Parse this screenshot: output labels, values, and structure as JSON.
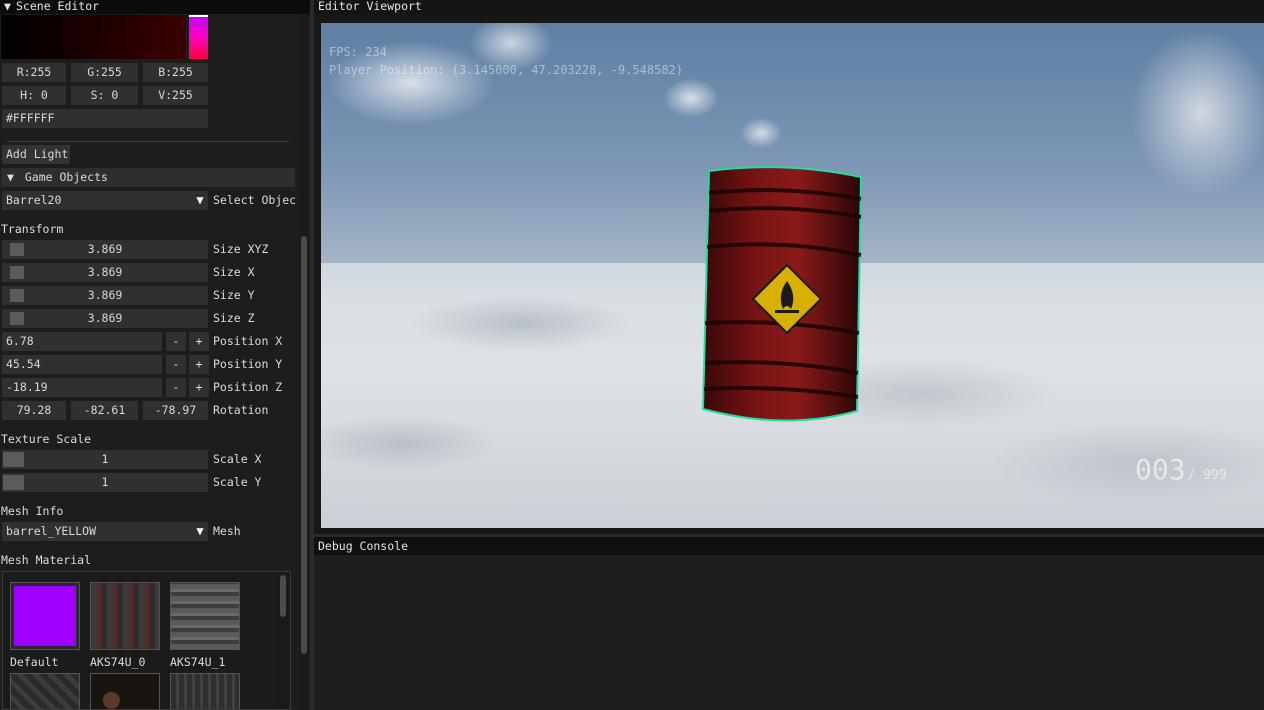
{
  "scene_editor": {
    "title": "Scene Editor",
    "color_picker": {
      "preview_color": "#ff00ff",
      "r": "R:255",
      "g": "G:255",
      "b": "B:255",
      "h": "H:  0",
      "s": "S:  0",
      "v": "V:255",
      "hex": "#FFFFFF"
    },
    "add_light_label": "Add Light",
    "game_objects_header": "Game Objects",
    "selected_object": "Barrel20",
    "select_object_label": "Select Object",
    "transform_label": "Transform",
    "size_xyz": {
      "value": "3.869",
      "label": "Size XYZ"
    },
    "size_x": {
      "value": "3.869",
      "label": "Size X"
    },
    "size_y": {
      "value": "3.869",
      "label": "Size Y"
    },
    "size_z": {
      "value": "3.869",
      "label": "Size Z"
    },
    "position_x": {
      "value": "6.78",
      "label": "Position X"
    },
    "position_y": {
      "value": "45.54",
      "label": "Position Y"
    },
    "position_z": {
      "value": "-18.19",
      "label": "Position Z"
    },
    "minus": "-",
    "plus": "+",
    "rotation": {
      "x": "79.28",
      "y": "-82.61",
      "z": "-78.97",
      "label": "Rotation"
    },
    "texture_scale_label": "Texture Scale",
    "scale_x": {
      "value": "1",
      "label": "Scale X"
    },
    "scale_y": {
      "value": "1",
      "label": "Scale Y"
    },
    "mesh_info_label": "Mesh Info",
    "mesh_value": "barrel_YELLOW",
    "mesh_label": "Mesh",
    "mesh_material_label": "Mesh Material",
    "materials": [
      {
        "name": "Default",
        "color": "#a000ff"
      },
      {
        "name": "AKS74U_0"
      },
      {
        "name": "AKS74U_1"
      }
    ],
    "triangle_icon": "▼"
  },
  "viewport": {
    "title": "Editor Viewport",
    "fps": "FPS: 234",
    "player_position": "Player Position: (3.145000, 47.203228, -9.548582)",
    "counter_current": "003",
    "counter_total": "/ 999",
    "barrel_color": "#7a1414",
    "outline_color": "#1de0a0"
  },
  "console": {
    "title": "Debug Console"
  }
}
